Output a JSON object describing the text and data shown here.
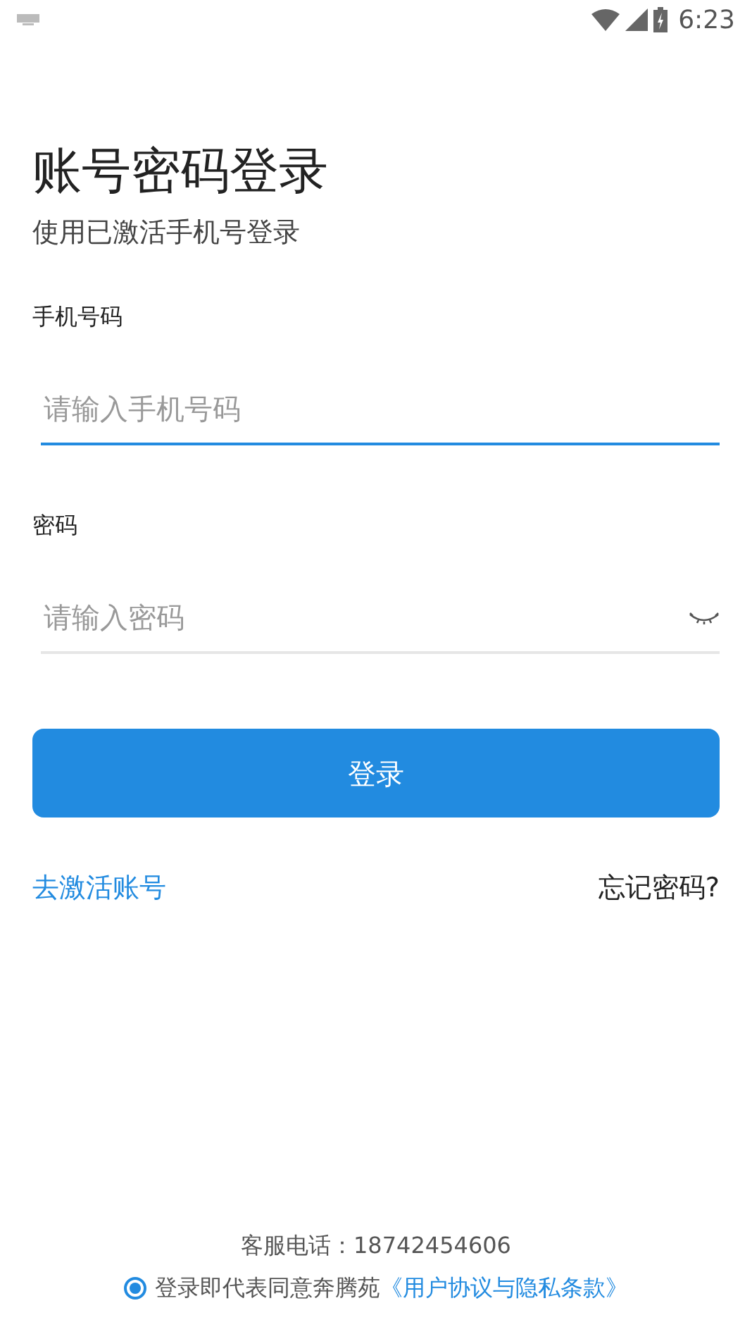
{
  "status_bar": {
    "time": "6:23"
  },
  "title": "账号密码登录",
  "subtitle": "使用已激活手机号登录",
  "phone_field": {
    "label": "手机号码",
    "placeholder": "请输入手机号码",
    "focused": true
  },
  "password_field": {
    "label": "密码",
    "placeholder": "请输入密码",
    "focused": false
  },
  "login_button": "登录",
  "links": {
    "activate": "去激活账号",
    "forgot": "忘记密码?"
  },
  "footer": {
    "service_phone": "客服电话：18742454606",
    "agreement": {
      "checked": true,
      "text": "登录即代表同意奔腾苑",
      "link": "《用户协议与隐私条款》"
    }
  }
}
